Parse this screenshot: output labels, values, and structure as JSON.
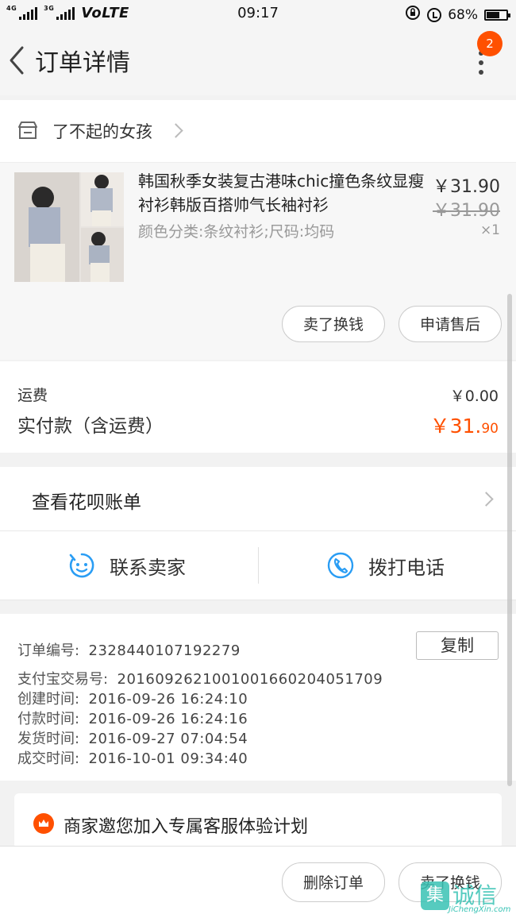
{
  "status_bar": {
    "network_small": "4G",
    "network_small2": "3G",
    "carrier": "VoLTE",
    "time": "09:17",
    "battery": "68%",
    "battery_level": 0.68
  },
  "header": {
    "title": "订单详情",
    "badge_count": "2"
  },
  "shop": {
    "name": "了不起的女孩"
  },
  "item": {
    "title": "韩国秋季女装复古港味chic撞色条纹显瘦衬衫韩版百搭帅气长袖衬衫",
    "sku": "颜色分类:条纹衬衫;尺码:均码",
    "price_now": "￥31.90",
    "price_old": "￥31.90",
    "qty": "×1",
    "actions": {
      "sell_label": "卖了换钱",
      "aftersale_label": "申请售后"
    }
  },
  "fees": {
    "shipping_label": "运费",
    "shipping_value": "￥0.00",
    "paid_label": "实付款（含运费）",
    "paid_main": "￥31.",
    "paid_decimal": "90"
  },
  "huabei": {
    "label": "查看花呗账单"
  },
  "contact": {
    "seller_label": "联系卖家",
    "phone_label": "拨打电话"
  },
  "order_info": {
    "copy_label": "复制",
    "lines": [
      {
        "key": "订单编号:",
        "value": "2328440107192279"
      },
      {
        "key": "支付宝交易号:",
        "value": "2016092621001001660204051709"
      },
      {
        "key": "创建时间:",
        "value": "2016-09-26 16:24:10"
      },
      {
        "key": "付款时间:",
        "value": "2016-09-26 16:24:16"
      },
      {
        "key": "发货时间:",
        "value": "2016-09-27 07:04:54"
      },
      {
        "key": "成交时间:",
        "value": "2016-10-01 09:34:40"
      }
    ]
  },
  "invite": {
    "text": "商家邀您加入专属客服体验计划"
  },
  "bottom_bar": {
    "delete_label": "删除订单",
    "sell_label": "卖了换钱"
  },
  "watermark": {
    "text": "诚信",
    "sub": "JiChengXin.com"
  },
  "colors": {
    "accent": "#ff5000",
    "contact_blue": "#2a9df4"
  }
}
